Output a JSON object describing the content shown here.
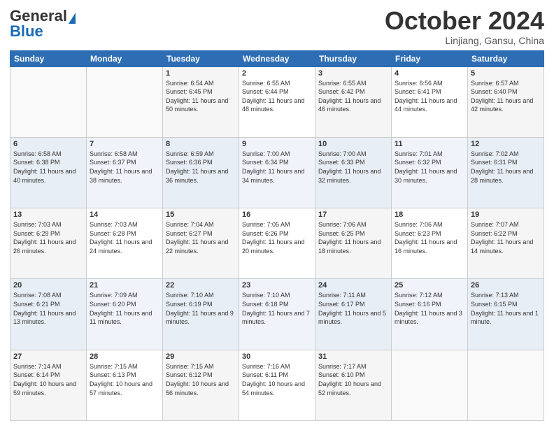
{
  "header": {
    "logo_line1": "General",
    "logo_line2": "Blue",
    "month": "October 2024",
    "location": "Linjiang, Gansu, China"
  },
  "weekdays": [
    "Sunday",
    "Monday",
    "Tuesday",
    "Wednesday",
    "Thursday",
    "Friday",
    "Saturday"
  ],
  "weeks": [
    [
      {
        "day": "",
        "sunrise": "",
        "sunset": "",
        "daylight": ""
      },
      {
        "day": "",
        "sunrise": "",
        "sunset": "",
        "daylight": ""
      },
      {
        "day": "1",
        "sunrise": "Sunrise: 6:54 AM",
        "sunset": "Sunset: 6:45 PM",
        "daylight": "Daylight: 11 hours and 50 minutes."
      },
      {
        "day": "2",
        "sunrise": "Sunrise: 6:55 AM",
        "sunset": "Sunset: 6:44 PM",
        "daylight": "Daylight: 11 hours and 48 minutes."
      },
      {
        "day": "3",
        "sunrise": "Sunrise: 6:55 AM",
        "sunset": "Sunset: 6:42 PM",
        "daylight": "Daylight: 11 hours and 46 minutes."
      },
      {
        "day": "4",
        "sunrise": "Sunrise: 6:56 AM",
        "sunset": "Sunset: 6:41 PM",
        "daylight": "Daylight: 11 hours and 44 minutes."
      },
      {
        "day": "5",
        "sunrise": "Sunrise: 6:57 AM",
        "sunset": "Sunset: 6:40 PM",
        "daylight": "Daylight: 11 hours and 42 minutes."
      }
    ],
    [
      {
        "day": "6",
        "sunrise": "Sunrise: 6:58 AM",
        "sunset": "Sunset: 6:38 PM",
        "daylight": "Daylight: 11 hours and 40 minutes."
      },
      {
        "day": "7",
        "sunrise": "Sunrise: 6:58 AM",
        "sunset": "Sunset: 6:37 PM",
        "daylight": "Daylight: 11 hours and 38 minutes."
      },
      {
        "day": "8",
        "sunrise": "Sunrise: 6:59 AM",
        "sunset": "Sunset: 6:36 PM",
        "daylight": "Daylight: 11 hours and 36 minutes."
      },
      {
        "day": "9",
        "sunrise": "Sunrise: 7:00 AM",
        "sunset": "Sunset: 6:34 PM",
        "daylight": "Daylight: 11 hours and 34 minutes."
      },
      {
        "day": "10",
        "sunrise": "Sunrise: 7:00 AM",
        "sunset": "Sunset: 6:33 PM",
        "daylight": "Daylight: 11 hours and 32 minutes."
      },
      {
        "day": "11",
        "sunrise": "Sunrise: 7:01 AM",
        "sunset": "Sunset: 6:32 PM",
        "daylight": "Daylight: 11 hours and 30 minutes."
      },
      {
        "day": "12",
        "sunrise": "Sunrise: 7:02 AM",
        "sunset": "Sunset: 6:31 PM",
        "daylight": "Daylight: 11 hours and 28 minutes."
      }
    ],
    [
      {
        "day": "13",
        "sunrise": "Sunrise: 7:03 AM",
        "sunset": "Sunset: 6:29 PM",
        "daylight": "Daylight: 11 hours and 26 minutes."
      },
      {
        "day": "14",
        "sunrise": "Sunrise: 7:03 AM",
        "sunset": "Sunset: 6:28 PM",
        "daylight": "Daylight: 11 hours and 24 minutes."
      },
      {
        "day": "15",
        "sunrise": "Sunrise: 7:04 AM",
        "sunset": "Sunset: 6:27 PM",
        "daylight": "Daylight: 11 hours and 22 minutes."
      },
      {
        "day": "16",
        "sunrise": "Sunrise: 7:05 AM",
        "sunset": "Sunset: 6:26 PM",
        "daylight": "Daylight: 11 hours and 20 minutes."
      },
      {
        "day": "17",
        "sunrise": "Sunrise: 7:06 AM",
        "sunset": "Sunset: 6:25 PM",
        "daylight": "Daylight: 11 hours and 18 minutes."
      },
      {
        "day": "18",
        "sunrise": "Sunrise: 7:06 AM",
        "sunset": "Sunset: 6:23 PM",
        "daylight": "Daylight: 11 hours and 16 minutes."
      },
      {
        "day": "19",
        "sunrise": "Sunrise: 7:07 AM",
        "sunset": "Sunset: 6:22 PM",
        "daylight": "Daylight: 11 hours and 14 minutes."
      }
    ],
    [
      {
        "day": "20",
        "sunrise": "Sunrise: 7:08 AM",
        "sunset": "Sunset: 6:21 PM",
        "daylight": "Daylight: 11 hours and 13 minutes."
      },
      {
        "day": "21",
        "sunrise": "Sunrise: 7:09 AM",
        "sunset": "Sunset: 6:20 PM",
        "daylight": "Daylight: 11 hours and 11 minutes."
      },
      {
        "day": "22",
        "sunrise": "Sunrise: 7:10 AM",
        "sunset": "Sunset: 6:19 PM",
        "daylight": "Daylight: 11 hours and 9 minutes."
      },
      {
        "day": "23",
        "sunrise": "Sunrise: 7:10 AM",
        "sunset": "Sunset: 6:18 PM",
        "daylight": "Daylight: 11 hours and 7 minutes."
      },
      {
        "day": "24",
        "sunrise": "Sunrise: 7:11 AM",
        "sunset": "Sunset: 6:17 PM",
        "daylight": "Daylight: 11 hours and 5 minutes."
      },
      {
        "day": "25",
        "sunrise": "Sunrise: 7:12 AM",
        "sunset": "Sunset: 6:16 PM",
        "daylight": "Daylight: 11 hours and 3 minutes."
      },
      {
        "day": "26",
        "sunrise": "Sunrise: 7:13 AM",
        "sunset": "Sunset: 6:15 PM",
        "daylight": "Daylight: 11 hours and 1 minute."
      }
    ],
    [
      {
        "day": "27",
        "sunrise": "Sunrise: 7:14 AM",
        "sunset": "Sunset: 6:14 PM",
        "daylight": "Daylight: 10 hours and 59 minutes."
      },
      {
        "day": "28",
        "sunrise": "Sunrise: 7:15 AM",
        "sunset": "Sunset: 6:13 PM",
        "daylight": "Daylight: 10 hours and 57 minutes."
      },
      {
        "day": "29",
        "sunrise": "Sunrise: 7:15 AM",
        "sunset": "Sunset: 6:12 PM",
        "daylight": "Daylight: 10 hours and 56 minutes."
      },
      {
        "day": "30",
        "sunrise": "Sunrise: 7:16 AM",
        "sunset": "Sunset: 6:11 PM",
        "daylight": "Daylight: 10 hours and 54 minutes."
      },
      {
        "day": "31",
        "sunrise": "Sunrise: 7:17 AM",
        "sunset": "Sunset: 6:10 PM",
        "daylight": "Daylight: 10 hours and 52 minutes."
      },
      {
        "day": "",
        "sunrise": "",
        "sunset": "",
        "daylight": ""
      },
      {
        "day": "",
        "sunrise": "",
        "sunset": "",
        "daylight": ""
      }
    ]
  ],
  "accent_color": "#2d6db4"
}
